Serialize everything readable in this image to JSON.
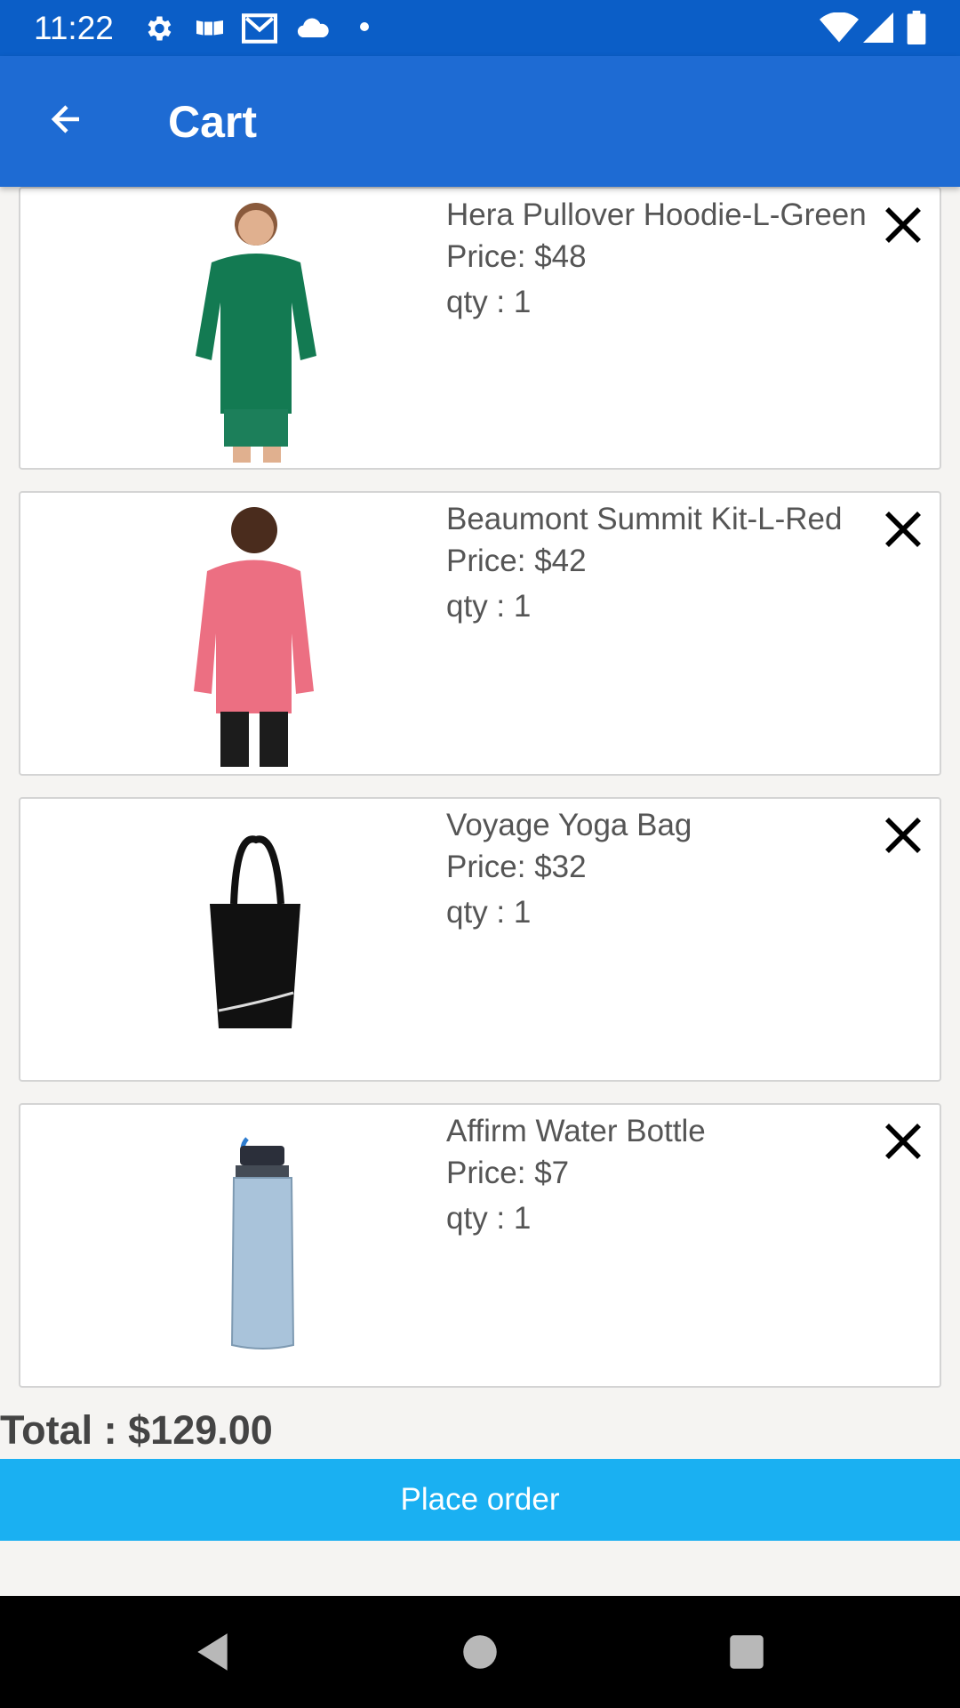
{
  "status_bar": {
    "time": "11:22",
    "icons": [
      "gear-icon",
      "news-icon",
      "mail-icon",
      "cloud-icon",
      "dot-icon",
      "wifi-icon",
      "signal-icon",
      "battery-icon"
    ]
  },
  "app_bar": {
    "title": "Cart",
    "back_icon": "arrow-left-icon"
  },
  "cart": {
    "items": [
      {
        "name": "Hera Pullover Hoodie-L-Green",
        "price": "Price: $48",
        "qty": "qty : 1",
        "image": "green-hoodie"
      },
      {
        "name": "Beaumont Summit Kit-L-Red",
        "price": "Price: $42",
        "qty": "qty : 1",
        "image": "red-jacket"
      },
      {
        "name": "Voyage Yoga Bag",
        "price": "Price: $32",
        "qty": "qty : 1",
        "image": "black-bag"
      },
      {
        "name": "Affirm Water Bottle",
        "price": "Price: $7",
        "qty": "qty : 1",
        "image": "water-bottle"
      }
    ]
  },
  "total": "Total : $129.00",
  "place_order_label": "Place order",
  "colors": {
    "status_bar": "#0b5ec7",
    "app_bar": "#1e6bd3",
    "button": "#1ab0f2"
  }
}
